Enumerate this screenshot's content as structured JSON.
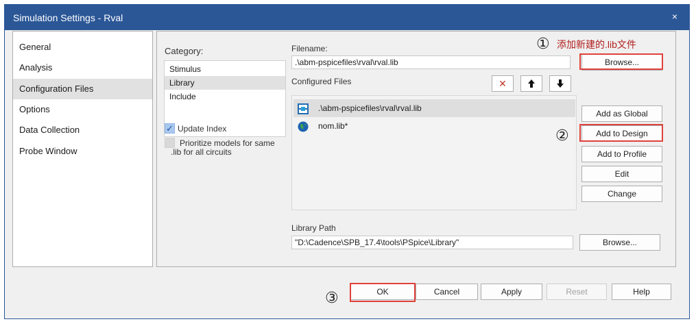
{
  "window": {
    "title": "Simulation Settings - Rval",
    "close_glyph": "×"
  },
  "nav": {
    "items": [
      {
        "label": "General"
      },
      {
        "label": "Analysis"
      },
      {
        "label": "Configuration Files"
      },
      {
        "label": "Options"
      },
      {
        "label": "Data Collection"
      },
      {
        "label": "Probe Window"
      }
    ],
    "selected": "Configuration Files"
  },
  "category": {
    "label": "Category:",
    "items": [
      "Stimulus",
      "Library",
      "Include"
    ],
    "selected": "Library"
  },
  "options": {
    "update_index": {
      "label": "Update Index",
      "checked": true
    },
    "prioritize": {
      "label_line1": "Prioritize models for same",
      "label_line2": ".lib for all circuits",
      "checked": false
    }
  },
  "filename": {
    "label": "Filename:",
    "value": ".\\abm-pspicefiles\\rval\\rval.lib",
    "browse_label": "Browse..."
  },
  "configured": {
    "label": "Configured Files",
    "files": [
      {
        "name": ".\\abm-pspicefiles\\rval\\rval.lib",
        "icon": "design-library-icon",
        "selected": true
      },
      {
        "name": "nom.lib*",
        "icon": "global-library-icon",
        "selected": false
      }
    ],
    "delete_glyph": "✕",
    "up_glyph": "🡅",
    "down_glyph": "🡇"
  },
  "actions": {
    "add_global": "Add as Global",
    "add_design": "Add to Design",
    "add_profile": "Add to Profile",
    "edit": "Edit",
    "change": "Change"
  },
  "library_path": {
    "label": "Library Path",
    "value": "\"D:\\Cadence\\SPB_17.4\\tools\\PSpice\\Library\"",
    "browse_label": "Browse..."
  },
  "footer": {
    "ok": "OK",
    "cancel": "Cancel",
    "apply": "Apply",
    "reset": "Reset",
    "help": "Help"
  },
  "annotations": {
    "step1_marker": "①",
    "step1_text": "添加新建的.lib文件",
    "step2_marker": "②",
    "step3_marker": "③",
    "highlight_color": "#e0413a"
  },
  "colors": {
    "titlebar": "#2b5797",
    "selection": "#e1e1e1",
    "annotation_text": "#b0201e"
  }
}
